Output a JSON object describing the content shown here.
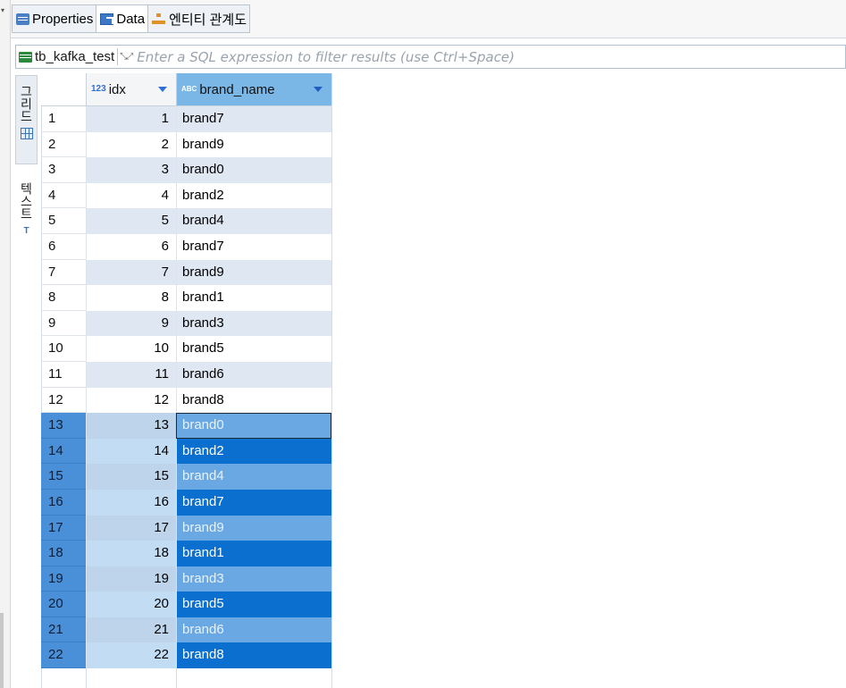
{
  "tabs": [
    {
      "label": "Properties",
      "icon": "properties-icon",
      "active": false
    },
    {
      "label": "Data",
      "icon": "data-icon",
      "active": true
    },
    {
      "label": "엔티티 관계도",
      "icon": "er-diagram-icon",
      "active": false
    }
  ],
  "filter": {
    "table_name": "tb_kafka_test",
    "placeholder": "Enter a SQL expression to filter results (use Ctrl+Space)"
  },
  "side_tabs": {
    "grid_label": "그리드",
    "text_label": "텍스트"
  },
  "columns": [
    {
      "name": "idx",
      "type_badge": "123"
    },
    {
      "name": "brand_name",
      "type_badge": "ABC"
    }
  ],
  "rows": [
    {
      "num": "1",
      "idx": "1",
      "brand": "brand7"
    },
    {
      "num": "2",
      "idx": "2",
      "brand": "brand9"
    },
    {
      "num": "3",
      "idx": "3",
      "brand": "brand0"
    },
    {
      "num": "4",
      "idx": "4",
      "brand": "brand2"
    },
    {
      "num": "5",
      "idx": "5",
      "brand": "brand4"
    },
    {
      "num": "6",
      "idx": "6",
      "brand": "brand7"
    },
    {
      "num": "7",
      "idx": "7",
      "brand": "brand9"
    },
    {
      "num": "8",
      "idx": "8",
      "brand": "brand1"
    },
    {
      "num": "9",
      "idx": "9",
      "brand": "brand3"
    },
    {
      "num": "10",
      "idx": "10",
      "brand": "brand5"
    },
    {
      "num": "11",
      "idx": "11",
      "brand": "brand6"
    },
    {
      "num": "12",
      "idx": "12",
      "brand": "brand8"
    },
    {
      "num": "13",
      "idx": "13",
      "brand": "brand0"
    },
    {
      "num": "14",
      "idx": "14",
      "brand": "brand2"
    },
    {
      "num": "15",
      "idx": "15",
      "brand": "brand4"
    },
    {
      "num": "16",
      "idx": "16",
      "brand": "brand7"
    },
    {
      "num": "17",
      "idx": "17",
      "brand": "brand9"
    },
    {
      "num": "18",
      "idx": "18",
      "brand": "brand1"
    },
    {
      "num": "19",
      "idx": "19",
      "brand": "brand3"
    },
    {
      "num": "20",
      "idx": "20",
      "brand": "brand5"
    },
    {
      "num": "21",
      "idx": "21",
      "brand": "brand6"
    },
    {
      "num": "22",
      "idx": "22",
      "brand": "brand8"
    }
  ],
  "selection": {
    "first_selected_row": 13,
    "last_selected_row": 22,
    "focused_row": 13
  },
  "colors": {
    "header_selected": "#7ab6e6",
    "row_alt": "#dfe7f2",
    "selection_dark": "#0b6fd0",
    "selection_light": "#6aa8e4",
    "rownum_selected": "#4a90d9"
  }
}
